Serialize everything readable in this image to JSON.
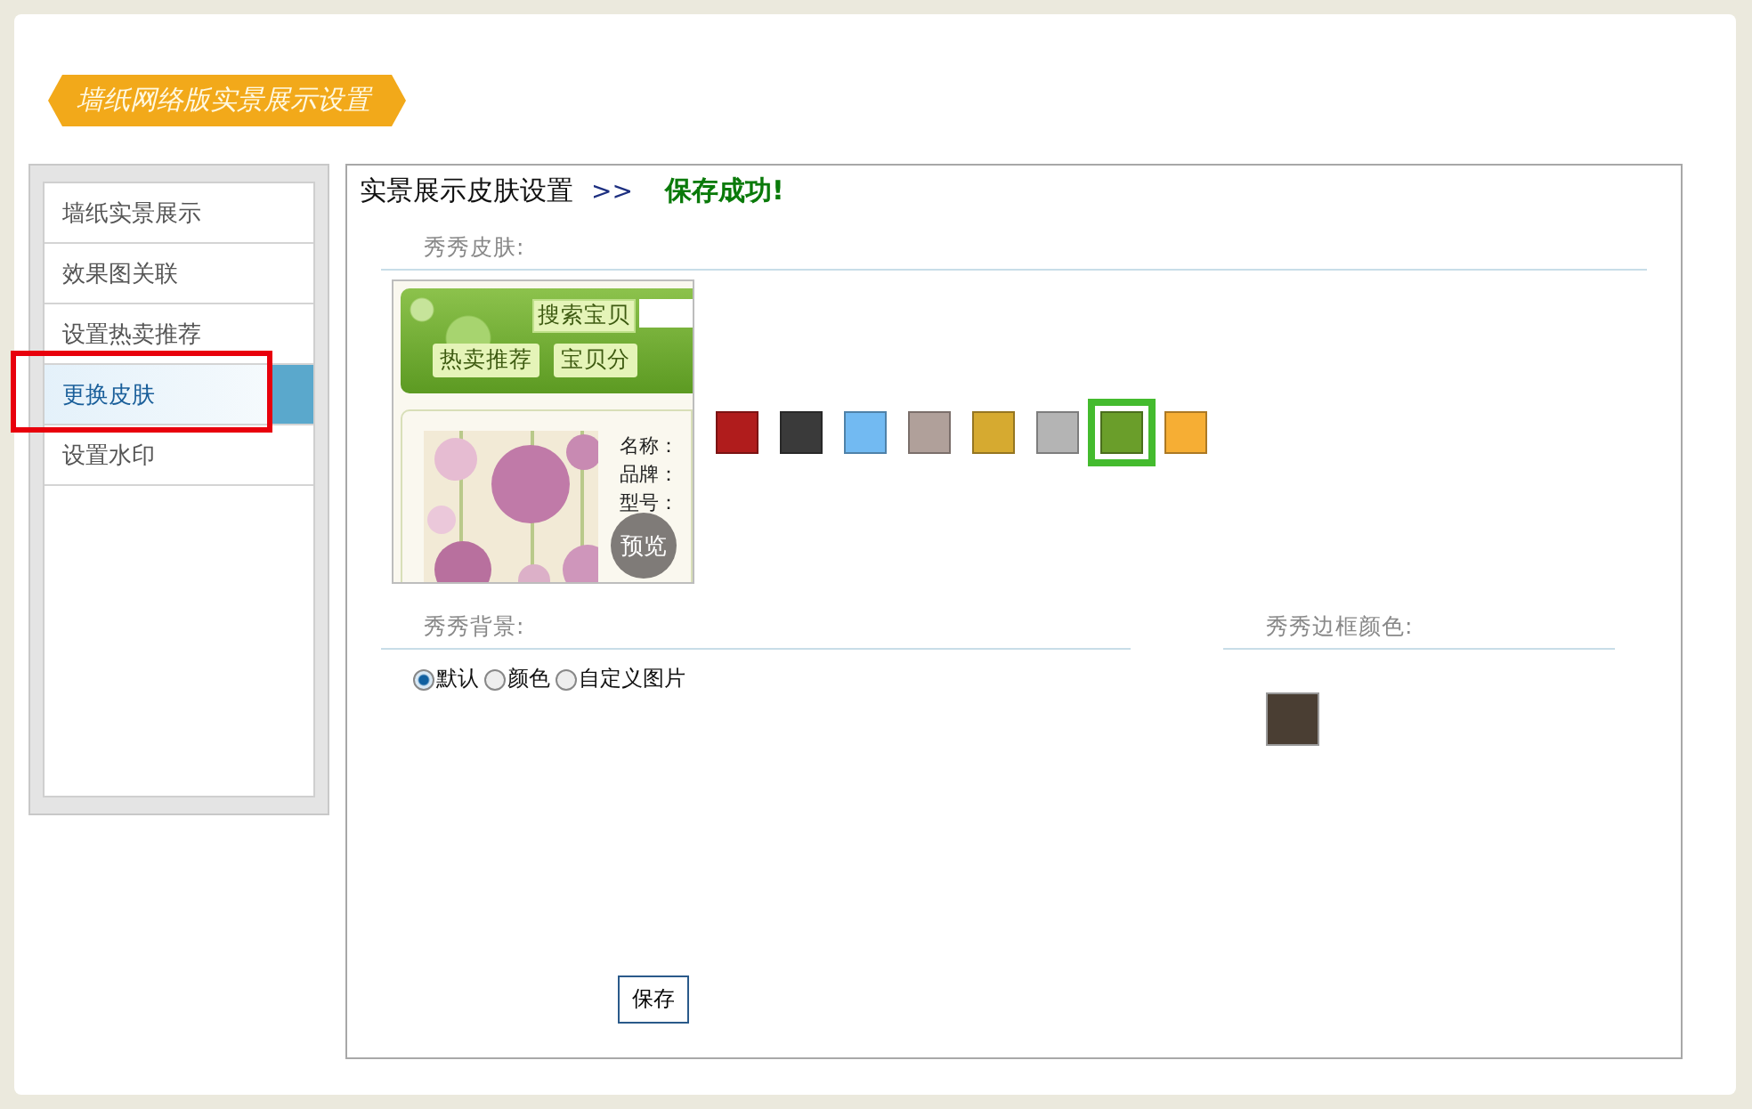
{
  "banner": {
    "title": "墙纸网络版实景展示设置"
  },
  "sidebar": {
    "items": [
      {
        "label": "墙纸实景展示",
        "selected": false
      },
      {
        "label": "效果图关联",
        "selected": false
      },
      {
        "label": "设置热卖推荐",
        "selected": false
      },
      {
        "label": "更换皮肤",
        "selected": true,
        "highlighted": true
      },
      {
        "label": "设置水印",
        "selected": false
      }
    ]
  },
  "main": {
    "breadcrumb": "实景展示皮肤设置",
    "separator": ">>",
    "status": "保存成功!",
    "skin_section": {
      "title": "秀秀皮肤:",
      "preview": {
        "search_label": "搜索宝贝",
        "nav": [
          "热卖推荐",
          "宝贝分"
        ],
        "fields": [
          "名称：",
          "品牌：",
          "型号："
        ],
        "badge": "预览"
      },
      "swatches": [
        {
          "color": "#b01c1c",
          "selected": false
        },
        {
          "color": "#3a3a3a",
          "selected": false
        },
        {
          "color": "#72baf2",
          "selected": false
        },
        {
          "color": "#b0a09a",
          "selected": false
        },
        {
          "color": "#d6aa30",
          "selected": false
        },
        {
          "color": "#b4b4b4",
          "selected": false
        },
        {
          "color": "#6a9e2a",
          "selected": true
        },
        {
          "color": "#f6ae34",
          "selected": false
        }
      ]
    },
    "background_section": {
      "title": "秀秀背景:",
      "options": [
        {
          "label": "默认",
          "selected": true
        },
        {
          "label": "颜色",
          "selected": false
        },
        {
          "label": "自定义图片",
          "selected": false
        }
      ]
    },
    "border_section": {
      "title": "秀秀边框颜色:",
      "color": "#4a3e33"
    },
    "save_button": "保存"
  }
}
